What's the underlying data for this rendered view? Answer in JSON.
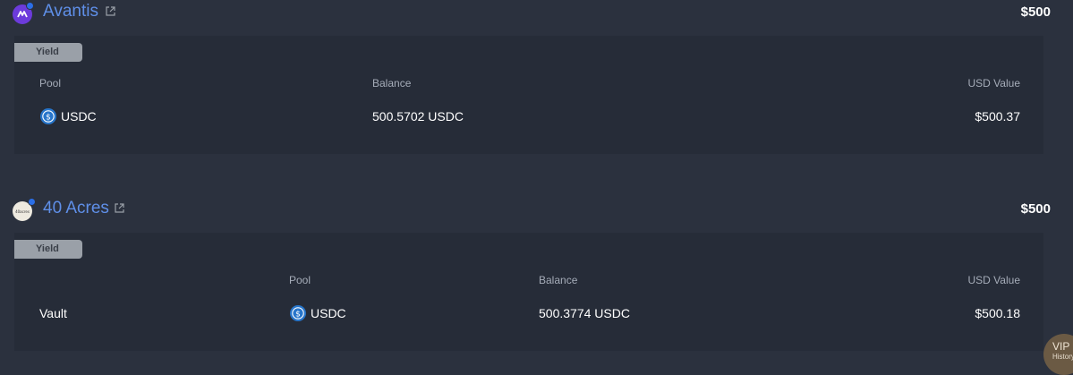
{
  "protocols": [
    {
      "name": "Avantis",
      "total": "$500",
      "tag": "Yield",
      "headers": {
        "pool": "Pool",
        "balance": "Balance",
        "usd_value": "USD Value"
      },
      "rows": [
        {
          "pool": "USDC",
          "balance": "500.5702 USDC",
          "usd_value": "$500.37"
        }
      ]
    },
    {
      "name": "40 Acres",
      "logo_text": "40acres",
      "total": "$500",
      "tag": "Yield",
      "headers": {
        "pool": "Pool",
        "balance": "Balance",
        "usd_value": "USD Value"
      },
      "rows": [
        {
          "name": "Vault",
          "pool": "USDC",
          "balance": "500.3774 USDC",
          "usd_value": "$500.18"
        }
      ]
    }
  ],
  "vip_widget": {
    "label": "VIP",
    "sub": "History"
  },
  "colors": {
    "background": "#2b313e",
    "panel": "#262c38",
    "link": "#5f8fe8",
    "tag": "#9aa0a8",
    "usdc": "#2775ca"
  }
}
